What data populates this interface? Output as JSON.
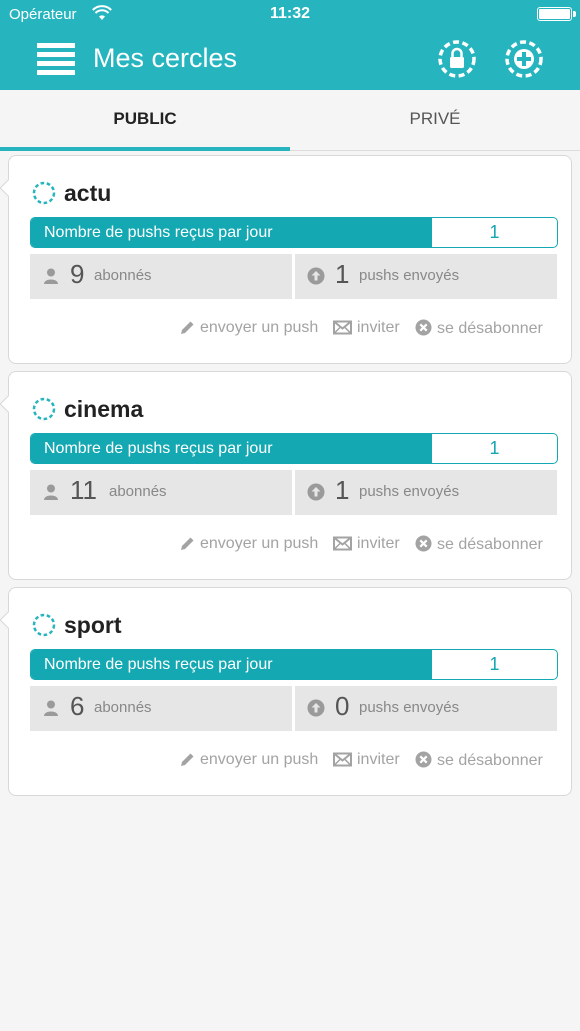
{
  "status_bar": {
    "carrier": "Opérateur",
    "time": "11:32"
  },
  "header": {
    "title": "Mes cercles",
    "menu_icon": "menu-icon",
    "lock_icon": "lock-circle-icon",
    "add_icon": "add-circle-icon"
  },
  "tabs": [
    {
      "label": "PUBLIC",
      "active": true
    },
    {
      "label": "PRIVÉ",
      "active": false
    }
  ],
  "labels": {
    "push_bar": "Nombre de pushs reçus par jour",
    "subscribers": "abonnés",
    "pushes_sent": "pushs envoyés",
    "send_push": "envoyer un push",
    "invite": "inviter",
    "unsubscribe": "se désabonner"
  },
  "circles": [
    {
      "name": "actu",
      "pushes_per_day": "1",
      "subscribers": "9",
      "pushes_sent": "1"
    },
    {
      "name": "cinema",
      "pushes_per_day": "1",
      "subscribers": "11",
      "pushes_sent": "1"
    },
    {
      "name": "sport",
      "pushes_per_day": "1",
      "subscribers": "6",
      "pushes_sent": "0"
    }
  ],
  "colors": {
    "accent": "#26b5bf",
    "bar": "#14a8b2",
    "stat_bg": "#e6e6e6",
    "action_text": "#a3a3a3"
  }
}
